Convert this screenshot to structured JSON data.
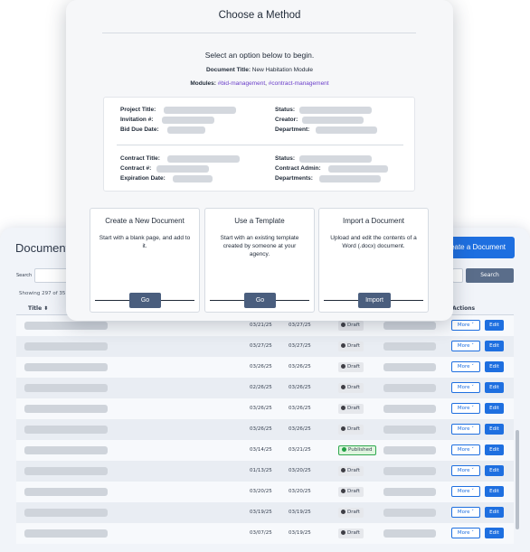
{
  "background": {
    "page_title": "Document",
    "create_button_label": "eate a Document",
    "search_label": "Search",
    "search_button_label": "Search",
    "showing_text": "Showing 297 of 35",
    "columns": {
      "title": "Title ⬍",
      "actions": "Actions"
    },
    "rows": [
      {
        "date1": "03/21/25",
        "date2": "03/27/25",
        "status": "Draft",
        "published": false
      },
      {
        "date1": "03/27/25",
        "date2": "03/27/25",
        "status": "Draft",
        "published": false
      },
      {
        "date1": "03/26/25",
        "date2": "03/26/25",
        "status": "Draft",
        "published": false
      },
      {
        "date1": "02/26/25",
        "date2": "03/26/25",
        "status": "Draft",
        "published": false
      },
      {
        "date1": "03/26/25",
        "date2": "03/26/25",
        "status": "Draft",
        "published": false
      },
      {
        "date1": "03/26/25",
        "date2": "03/26/25",
        "status": "Draft",
        "published": false
      },
      {
        "date1": "03/14/25",
        "date2": "03/21/25",
        "status": "Published",
        "published": true
      },
      {
        "date1": "01/13/25",
        "date2": "03/20/25",
        "status": "Draft",
        "published": false
      },
      {
        "date1": "03/20/25",
        "date2": "03/20/25",
        "status": "Draft",
        "published": false
      },
      {
        "date1": "03/19/25",
        "date2": "03/19/25",
        "status": "Draft",
        "published": false
      },
      {
        "date1": "03/07/25",
        "date2": "03/19/25",
        "status": "Draft",
        "published": false
      }
    ],
    "row_more_label": "More ˅",
    "row_edit_label": "Edit"
  },
  "modal": {
    "title": "Choose a Method",
    "subtitle": "Select an option below to begin.",
    "doc_title_label": "Document Title:",
    "doc_title_value": "New Habitation Module",
    "modules_label": "Modules:",
    "modules": [
      "#bid-management",
      "#contract-management"
    ],
    "modules_separator": ", ",
    "project": {
      "title_label": "Project Title:",
      "invitation_label": "Invitation #:",
      "bid_due_label": "Bid Due Date:",
      "status_label": "Status:",
      "creator_label": "Creator:",
      "department_label": "Department:"
    },
    "contract": {
      "title_label": "Contract Title:",
      "number_label": "Contract #:",
      "expiration_label": "Expiration Date:",
      "status_label": "Status:",
      "admin_label": "Contract Admin:",
      "departments_label": "Departments:"
    },
    "options": [
      {
        "title": "Create a New Document",
        "description": "Start with a blank page, and add to it.",
        "button": "Go"
      },
      {
        "title": "Use a Template",
        "description": "Start with an existing template created by someone at your agency.",
        "button": "Go"
      },
      {
        "title": "Import a Document",
        "description": "Upload and edit the contents of a Word (.docx) document.",
        "button": "Import"
      }
    ]
  },
  "colors": {
    "primary": "#1e6fe0",
    "button_dark": "#4a5e7e",
    "tag_purple": "#6b3fc9",
    "published_green": "#22a045"
  }
}
